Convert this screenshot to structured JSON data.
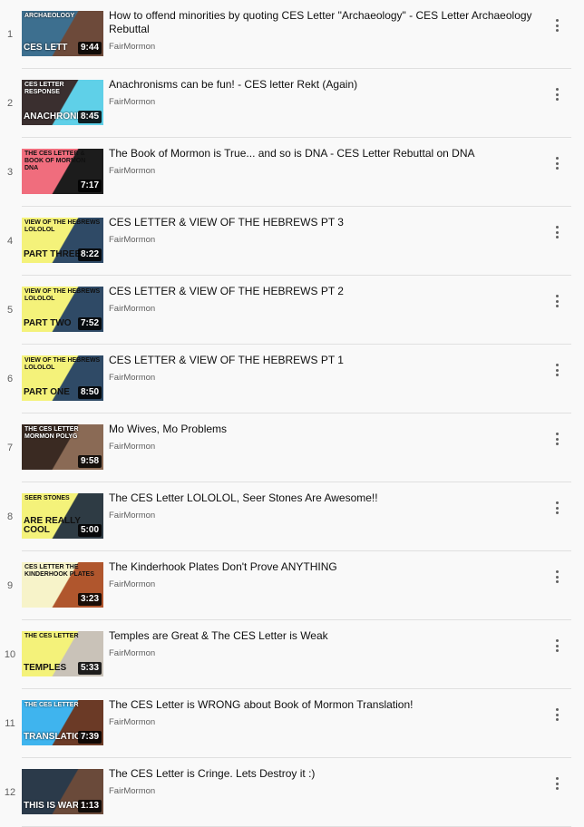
{
  "playlist": {
    "items": [
      {
        "index": "1",
        "title": "How to offend minorities by quoting CES Letter \"Archaeology\" - CES Letter Archaeology Rebuttal",
        "channel": "FairMormon",
        "duration": "9:44",
        "thumb_text": "ARCHAEOLOGY",
        "thumb_big": "CES LETT",
        "thumb_colors": [
          "#3d6f8f",
          "#6d4a3a"
        ]
      },
      {
        "index": "2",
        "title": "Anachronisms can be fun! - CES letter Rekt (Again)",
        "channel": "FairMormon",
        "duration": "8:45",
        "thumb_text": "CES LETTER RESPONSE",
        "thumb_big": "ANACHRONISM",
        "thumb_colors": [
          "#3a2f2f",
          "#5fd0e8"
        ]
      },
      {
        "index": "3",
        "title": "The Book of Mormon is True... and so is DNA - CES Letter Rebuttal on DNA",
        "channel": "FairMormon",
        "duration": "7:17",
        "thumb_text": "THE CES LETTER & BOOK OF MORMON DNA",
        "thumb_big": "",
        "thumb_colors": [
          "#f06d7d",
          "#1c1c1c"
        ]
      },
      {
        "index": "4",
        "title": "CES LETTER & VIEW OF THE HEBREWS PT 3",
        "channel": "FairMormon",
        "duration": "8:22",
        "thumb_text": "VIEW OF THE HEBREWS LOLOLOL",
        "thumb_big": "PART THREE",
        "thumb_colors": [
          "#f4f27a",
          "#2f4a66"
        ]
      },
      {
        "index": "5",
        "title": "CES LETTER & VIEW OF THE HEBREWS PT 2",
        "channel": "FairMormon",
        "duration": "7:52",
        "thumb_text": "VIEW OF THE HEBREWS LOLOLOL",
        "thumb_big": "PART TWO",
        "thumb_colors": [
          "#f4f27a",
          "#2f4a66"
        ]
      },
      {
        "index": "6",
        "title": "CES LETTER & VIEW OF THE HEBREWS PT 1",
        "channel": "FairMormon",
        "duration": "8:50",
        "thumb_text": "VIEW OF THE HEBREWS LOLOLOL",
        "thumb_big": "PART ONE",
        "thumb_colors": [
          "#f4f27a",
          "#2f4a66"
        ]
      },
      {
        "index": "7",
        "title": "Mo Wives, Mo Problems",
        "channel": "FairMormon",
        "duration": "9:58",
        "thumb_text": "THE CES LETTER MORMON POLYG",
        "thumb_big": "",
        "thumb_colors": [
          "#3a2a22",
          "#8a6a55"
        ]
      },
      {
        "index": "8",
        "title": "The CES Letter LOLOLOL, Seer Stones Are Awesome!!",
        "channel": "FairMormon",
        "duration": "5:00",
        "thumb_text": "SEER STONES",
        "thumb_big": "ARE REALLY COOL",
        "thumb_colors": [
          "#f4f27a",
          "#2e3b44"
        ]
      },
      {
        "index": "9",
        "title": "The Kinderhook Plates Don't Prove ANYTHING",
        "channel": "FairMormon",
        "duration": "3:23",
        "thumb_text": "CES LETTER THE KINDERHOOK PLATES",
        "thumb_big": "",
        "thumb_colors": [
          "#f7f3c9",
          "#b0562d"
        ]
      },
      {
        "index": "10",
        "title": "Temples are Great & The CES Letter is Weak",
        "channel": "FairMormon",
        "duration": "5:33",
        "thumb_text": "THE CES LETTER",
        "thumb_big": "TEMPLES",
        "thumb_colors": [
          "#f4f27a",
          "#c9c2b8"
        ]
      },
      {
        "index": "11",
        "title": "The CES Letter is WRONG about Book of Mormon Translation!",
        "channel": "FairMormon",
        "duration": "7:39",
        "thumb_text": "THE CES LETTER",
        "thumb_big": "TRANSLATION",
        "thumb_colors": [
          "#3fb4ee",
          "#6b3a26"
        ]
      },
      {
        "index": "12",
        "title": "The CES Letter is Cringe. Lets Destroy it :)",
        "channel": "FairMormon",
        "duration": "1:13",
        "thumb_text": "",
        "thumb_big": "THIS IS WAR",
        "thumb_colors": [
          "#2b3a4a",
          "#6a4a3a"
        ]
      }
    ]
  },
  "icons": {
    "row_menu": "more-vert-icon"
  },
  "colors": {
    "background": "#f9f9f9",
    "title_text": "#0f0f0f",
    "meta_text": "#606060",
    "divider": "#e0e0e0"
  }
}
